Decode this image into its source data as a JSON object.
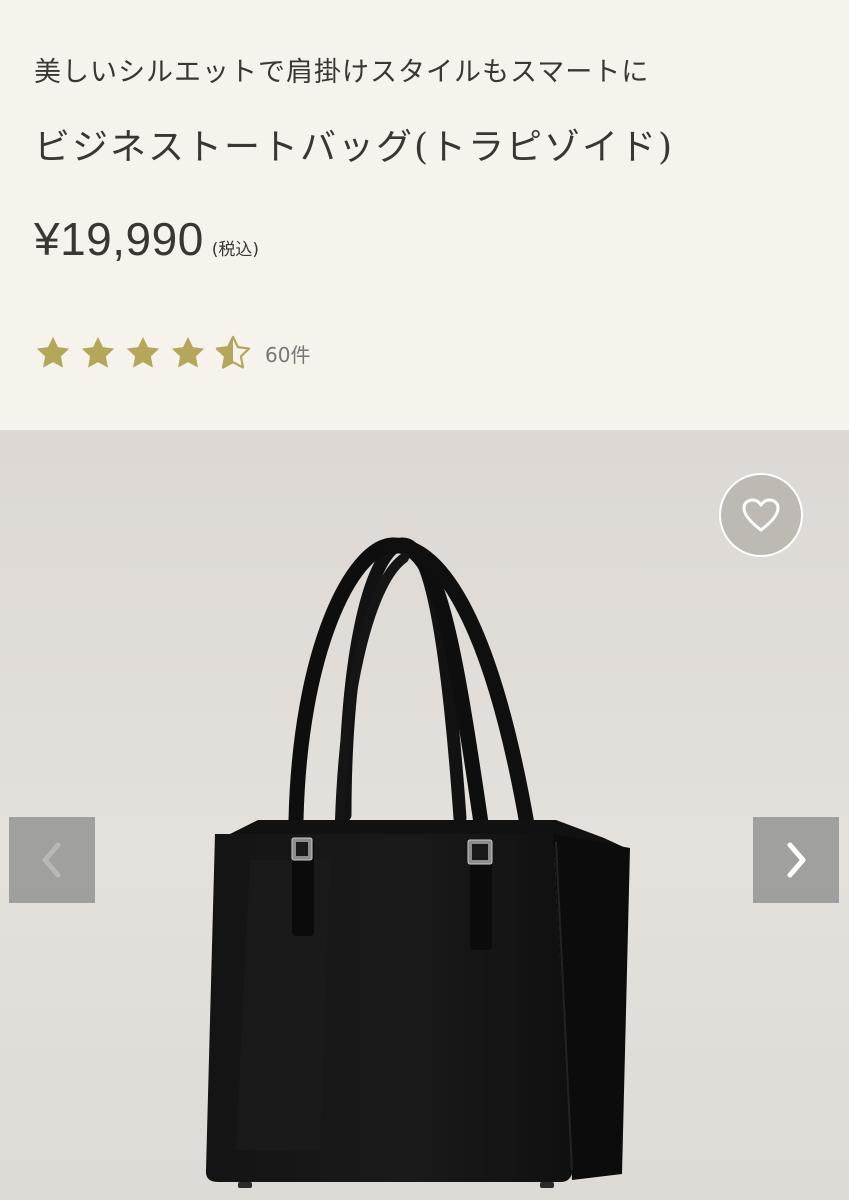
{
  "product": {
    "catch_copy": "美しいシルエットで肩掛けスタイルもスマートに",
    "name": "ビジネストートバッグ(トラピゾイド)",
    "price": "¥19,990",
    "tax_note": "(税込)",
    "rating": 4.5,
    "rating_max": 5,
    "review_count": "60件"
  },
  "gallery": {
    "favorite_icon": "heart-outline-icon",
    "prev_icon": "chevron-left-icon",
    "next_icon": "chevron-right-icon",
    "image": "black-leather-tote-bag"
  },
  "colors": {
    "background": "#f6f2ec",
    "text": "#3a3632",
    "star": "#b5a75a",
    "image_bg": "#e0dcd8",
    "bag": "#161616"
  }
}
